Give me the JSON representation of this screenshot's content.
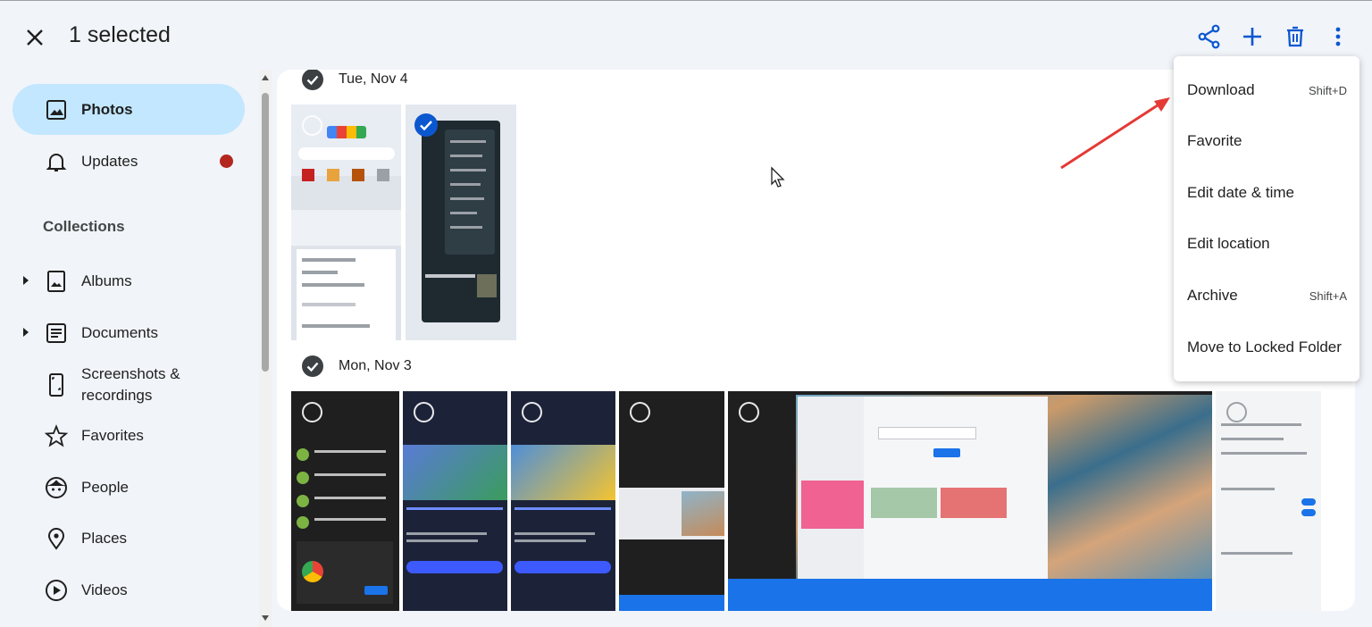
{
  "header": {
    "selection_title": "1 selected",
    "actions": [
      "share-icon",
      "add-icon",
      "trash-icon",
      "more-vert-icon"
    ],
    "accent": "#0b57d0"
  },
  "sidebar": {
    "items": [
      {
        "label": "Photos",
        "icon": "photo-icon",
        "active": true
      },
      {
        "label": "Updates",
        "icon": "bell-icon",
        "badge": true
      }
    ],
    "collections_label": "Collections",
    "collections": [
      {
        "label": "Albums",
        "icon": "album-icon",
        "expandable": true
      },
      {
        "label": "Documents",
        "icon": "document-icon",
        "expandable": true
      },
      {
        "label": "Screenshots &\nrecordings",
        "line1": "Screenshots &",
        "line2": "recordings",
        "icon": "phone-screenshot-icon"
      },
      {
        "label": "Favorites",
        "icon": "star-icon"
      },
      {
        "label": "People",
        "icon": "face-icon"
      },
      {
        "label": "Places",
        "icon": "location-pin-icon"
      },
      {
        "label": "Videos",
        "icon": "play-circle-icon"
      }
    ],
    "active_bg": "#c2e7ff",
    "badge_color": "#b3261e"
  },
  "groups": [
    {
      "date": "Tue, Nov 4",
      "photo_count": 2,
      "selected_index": 1
    },
    {
      "date": "Mon, Nov 3",
      "photo_count": 7
    }
  ],
  "menu": {
    "items": [
      {
        "label": "Download",
        "shortcut": "Shift+D"
      },
      {
        "label": "Favorite",
        "shortcut": ""
      },
      {
        "label": "Edit date & time",
        "shortcut": ""
      },
      {
        "label": "Edit location",
        "shortcut": ""
      },
      {
        "label": "Archive",
        "shortcut": "Shift+A"
      },
      {
        "label": "Move to Locked Folder",
        "shortcut": ""
      }
    ]
  },
  "annotation_color": "#e53935"
}
